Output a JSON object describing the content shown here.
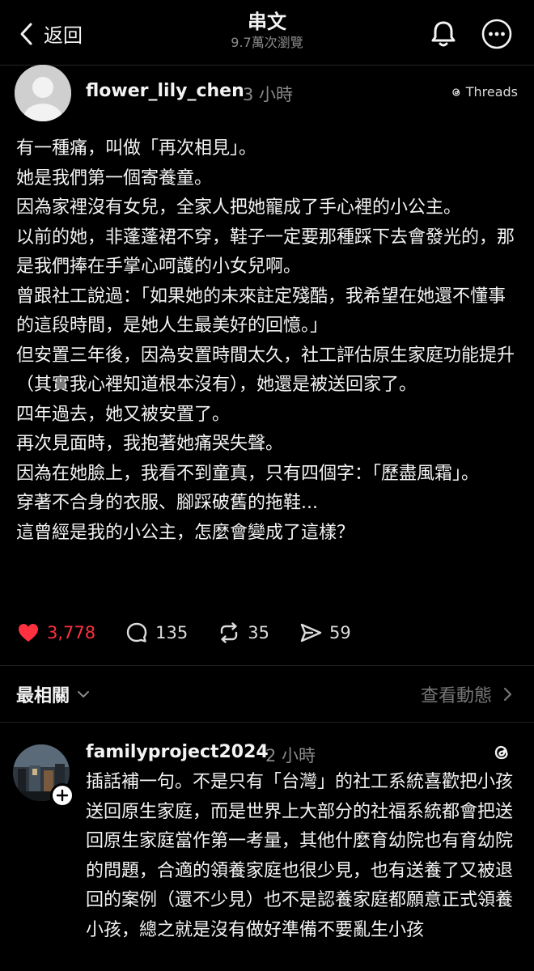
{
  "header": {
    "back_label": "返回",
    "title": "串文",
    "views": "9.7萬次瀏覽"
  },
  "post": {
    "username": "flower_lily_chen",
    "time": "3 小時",
    "source": "Threads",
    "lines": [
      "有一種痛，叫做「再次相見」。",
      "她是我們第一個寄養童。",
      "因為家裡沒有女兒，全家人把她寵成了手心裡的小公主。",
      "以前的她，非蓬蓬裙不穿，鞋子一定要那種踩下去會發光的，那是我們捧在手掌心呵護的小女兒啊。",
      "曾跟社工說過：「如果她的未來註定殘酷，我希望在她還不懂事的這段時間，是她人生最美好的回憶。」",
      "但安置三年後，因為安置時間太久，社工評估原生家庭功能提升（其實我心裡知道根本沒有），她還是被送回家了。",
      "四年過去，她又被安置了。",
      "再次見面時，我抱著她痛哭失聲。",
      "因為在她臉上，我看不到童真，只有四個字：「歷盡風霜」。",
      "穿著不合身的衣服、腳踩破舊的拖鞋...",
      "這曾經是我的小公主，怎麼會變成了這樣？"
    ],
    "likes": "3,778",
    "comments": "135",
    "reposts": "35",
    "shares": "59",
    "like_color": "#ff3040"
  },
  "replies_header": {
    "sort_label": "最相關",
    "view_activity": "查看動態"
  },
  "reply": {
    "username": "familyproject2024",
    "time": "2 小時",
    "text": "插話補一句。不是只有「台灣」的社工系統喜歡把小孩送回原生家庭，而是世界上大部分的社福系統都會把送回原生家庭當作第一考量，其他什麼育幼院也有育幼院的問題，合適的領養家庭也很少見，也有送養了又被退回的案例（還不少見）也不是認養家庭都願意正式領養小孩，總之就是沒有做好準備不要亂生小孩"
  },
  "icons": {
    "back": "chevron-left-icon",
    "bell": "bell-icon",
    "more": "more-icon",
    "like": "heart-icon",
    "comment": "comment-icon",
    "repost": "repost-icon",
    "share": "send-icon",
    "threads": "threads-logo-icon"
  }
}
